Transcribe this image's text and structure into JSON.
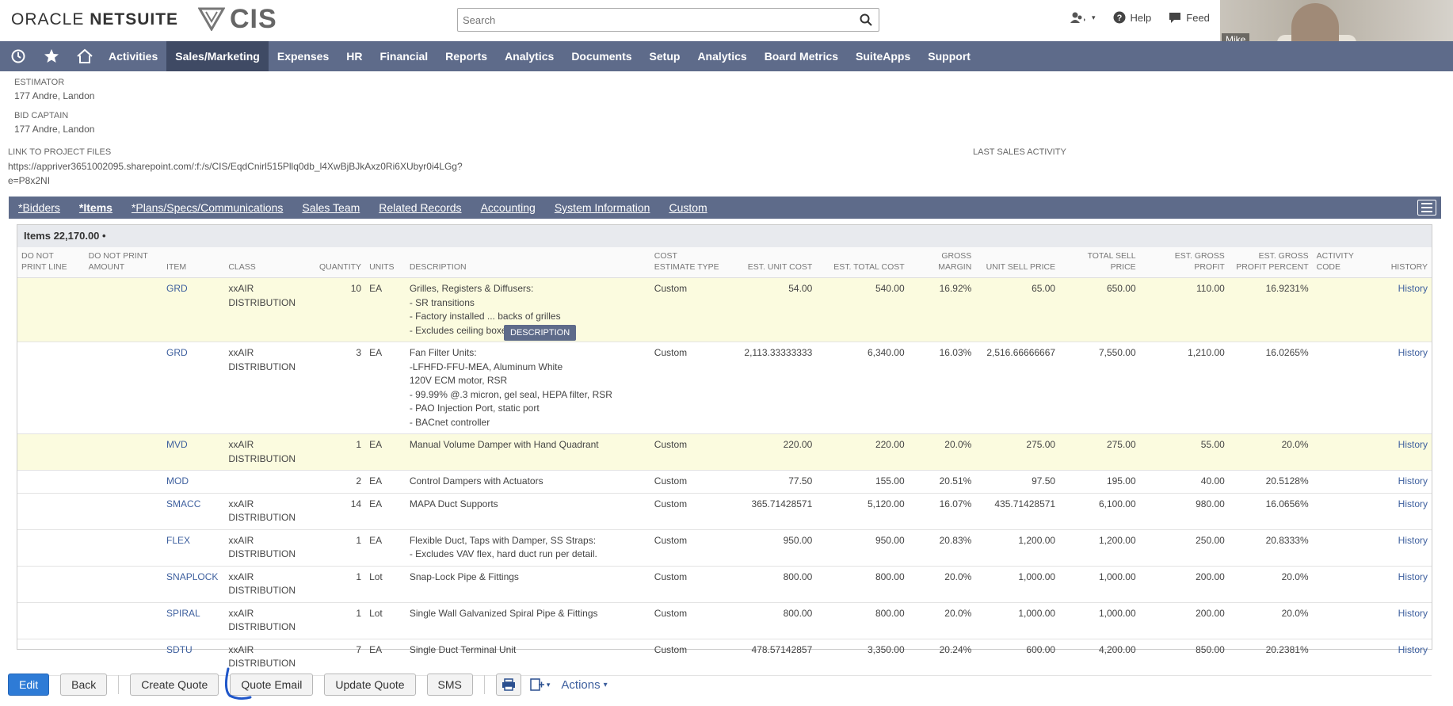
{
  "header": {
    "oracle": "ORACLE",
    "netsuite": "NETSUITE",
    "cis": "CIS",
    "search_placeholder": "Search",
    "help": "Help",
    "feedback": "Feed",
    "video_name": "Mike"
  },
  "nav": {
    "items": [
      "Activities",
      "Sales/Marketing",
      "Expenses",
      "HR",
      "Financial",
      "Reports",
      "Analytics",
      "Documents",
      "Setup",
      "Analytics",
      "Board Metrics",
      "SuiteApps",
      "Support"
    ],
    "active_index": 1
  },
  "fields": {
    "estimator_label": "ESTIMATOR",
    "estimator_value": "177 Andre, Landon",
    "bid_captain_label": "BID CAPTAIN",
    "bid_captain_value": "177 Andre, Landon",
    "project_files_label": "LINK TO PROJECT FILES",
    "project_files_value_1": "https://appriver3651002095.sharepoint.com/:f:/s/CIS/EqdCnirl515Pllq0db_l4XwBjBJkAxz0Ri6XUbyr0i4LGg?",
    "project_files_value_2": "e=P8x2NI",
    "last_sales_label": "LAST SALES ACTIVITY"
  },
  "subtabs": [
    "*Bidders",
    "*Items",
    "*Plans/Specs/Communications",
    "Sales Team",
    "Related Records",
    "Accounting",
    "System Information",
    "Custom"
  ],
  "items": {
    "title": "Items 22,170.00 •",
    "tooltip": "DESCRIPTION",
    "columns": {
      "do_not_print_line": "DO NOT PRINT LINE",
      "do_not_print_amount": "DO NOT PRINT AMOUNT",
      "item": "ITEM",
      "class": "CLASS",
      "quantity": "QUANTITY",
      "units": "UNITS",
      "description": "DESCRIPTION",
      "cost_estimate_type": "COST ESTIMATE TYPE",
      "est_unit_cost": "EST. UNIT COST",
      "est_total_cost": "EST. TOTAL COST",
      "gross_margin": "GROSS MARGIN",
      "unit_sell_price": "UNIT SELL PRICE",
      "total_sell_price": "TOTAL SELL PRICE",
      "est_gross_profit": "EST. GROSS PROFIT",
      "est_gross_profit_percent": "EST. GROSS PROFIT PERCENT",
      "activity_code": "ACTIVITY CODE",
      "history": "HISTORY"
    },
    "rows": [
      {
        "item": "GRD",
        "class": "xxAIR DISTRIBUTION",
        "qty": "10",
        "units": "EA",
        "desc": [
          "Grilles, Registers & Diffusers:",
          "- SR transitions",
          "- Factory installed ... backs of grilles",
          "- Excludes ceiling boxes"
        ],
        "cet": "Custom",
        "euc": "54.00",
        "etc": "540.00",
        "gm": "16.92%",
        "usp": "65.00",
        "tsp": "650.00",
        "egp": "110.00",
        "egpp": "16.9231%",
        "hist": "History",
        "hl": true
      },
      {
        "item": "GRD",
        "class": "xxAIR DISTRIBUTION",
        "qty": "3",
        "units": "EA",
        "desc": [
          "Fan Filter Units:",
          "-LFHFD-FFU-MEA, Aluminum White",
          "120V ECM motor, RSR",
          "- 99.99% @.3 micron, gel seal, HEPA filter, RSR",
          "- PAO Injection Port, static port",
          "- BACnet controller"
        ],
        "cet": "Custom",
        "euc": "2,113.33333333",
        "etc": "6,340.00",
        "gm": "16.03%",
        "usp": "2,516.66666667",
        "tsp": "7,550.00",
        "egp": "1,210.00",
        "egpp": "16.0265%",
        "hist": "History",
        "hl": false
      },
      {
        "item": "MVD",
        "class": "xxAIR DISTRIBUTION",
        "qty": "1",
        "units": "EA",
        "desc": [
          "Manual Volume Damper with Hand Quadrant"
        ],
        "cet": "Custom",
        "euc": "220.00",
        "etc": "220.00",
        "gm": "20.0%",
        "usp": "275.00",
        "tsp": "275.00",
        "egp": "55.00",
        "egpp": "20.0%",
        "hist": "History",
        "hl": true
      },
      {
        "item": "MOD",
        "class": "",
        "qty": "2",
        "units": "EA",
        "desc": [
          "Control Dampers with Actuators"
        ],
        "cet": "Custom",
        "euc": "77.50",
        "etc": "155.00",
        "gm": "20.51%",
        "usp": "97.50",
        "tsp": "195.00",
        "egp": "40.00",
        "egpp": "20.5128%",
        "hist": "History",
        "hl": false
      },
      {
        "item": "SMACC",
        "class": "xxAIR DISTRIBUTION",
        "qty": "14",
        "units": "EA",
        "desc": [
          "MAPA Duct Supports"
        ],
        "cet": "Custom",
        "euc": "365.71428571",
        "etc": "5,120.00",
        "gm": "16.07%",
        "usp": "435.71428571",
        "tsp": "6,100.00",
        "egp": "980.00",
        "egpp": "16.0656%",
        "hist": "History",
        "hl": false
      },
      {
        "item": "FLEX",
        "class": "xxAIR DISTRIBUTION",
        "qty": "1",
        "units": "EA",
        "desc": [
          "Flexible Duct, Taps with Damper, SS Straps:",
          "- Excludes VAV flex, hard duct run per detail."
        ],
        "cet": "Custom",
        "euc": "950.00",
        "etc": "950.00",
        "gm": "20.83%",
        "usp": "1,200.00",
        "tsp": "1,200.00",
        "egp": "250.00",
        "egpp": "20.8333%",
        "hist": "History",
        "hl": false
      },
      {
        "item": "SNAPLOCK",
        "class": "xxAIR DISTRIBUTION",
        "qty": "1",
        "units": "Lot",
        "desc": [
          "Snap-Lock Pipe & Fittings"
        ],
        "cet": "Custom",
        "euc": "800.00",
        "etc": "800.00",
        "gm": "20.0%",
        "usp": "1,000.00",
        "tsp": "1,000.00",
        "egp": "200.00",
        "egpp": "20.0%",
        "hist": "History",
        "hl": false
      },
      {
        "item": "SPIRAL",
        "class": "xxAIR DISTRIBUTION",
        "qty": "1",
        "units": "Lot",
        "desc": [
          "Single Wall Galvanized Spiral Pipe & Fittings"
        ],
        "cet": "Custom",
        "euc": "800.00",
        "etc": "800.00",
        "gm": "20.0%",
        "usp": "1,000.00",
        "tsp": "1,000.00",
        "egp": "200.00",
        "egpp": "20.0%",
        "hist": "History",
        "hl": false
      },
      {
        "item": "SDTU",
        "class": "xxAIR DISTRIBUTION",
        "qty": "7",
        "units": "EA",
        "desc": [
          "Single Duct Terminal Unit"
        ],
        "cet": "Custom",
        "euc": "478.57142857",
        "etc": "3,350.00",
        "gm": "20.24%",
        "usp": "600.00",
        "tsp": "4,200.00",
        "egp": "850.00",
        "egpp": "20.2381%",
        "hist": "History",
        "hl": false
      }
    ]
  },
  "buttons": {
    "edit": "Edit",
    "back": "Back",
    "create_quote": "Create Quote",
    "quote_email": "Quote Email",
    "update_quote": "Update Quote",
    "sms": "SMS",
    "actions": "Actions"
  },
  "colors": {
    "nav_bg": "#5e6b8a",
    "nav_active": "#3f4a64",
    "primary_button": "#2e7bd6",
    "link": "#3d5f9e",
    "row_highlight": "#fbfbdf"
  }
}
